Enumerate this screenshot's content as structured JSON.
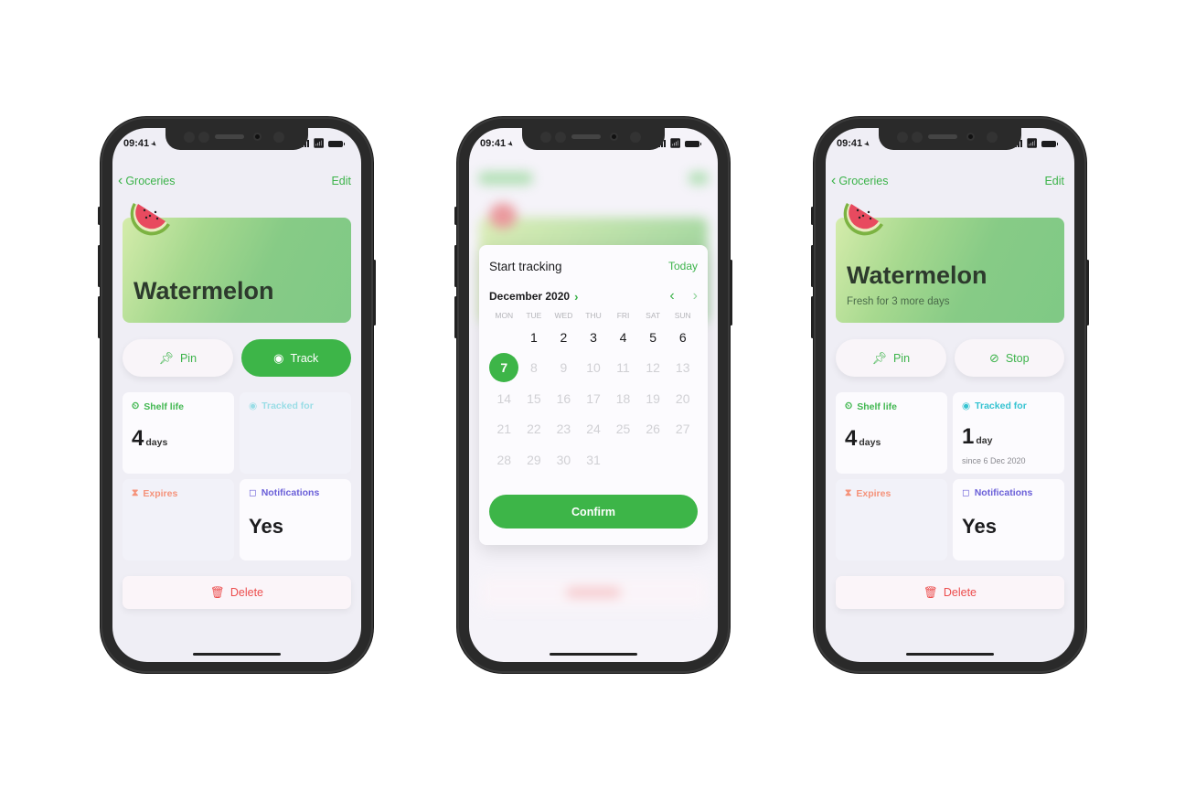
{
  "status_bar": {
    "time": "09:41"
  },
  "screens": [
    {
      "nav": {
        "back_label": "Groceries",
        "edit_label": "Edit"
      },
      "hero": {
        "title": "Watermelon",
        "subtitle": null
      },
      "actions": {
        "pin_label": "Pin",
        "track_label": "Track"
      },
      "cells": {
        "shelf_life": {
          "label": "Shelf life",
          "value": "4",
          "unit": "days"
        },
        "tracked_for": {
          "label": "Tracked for"
        },
        "expires": {
          "label": "Expires"
        },
        "notifications": {
          "label": "Notifications",
          "value": "Yes"
        }
      },
      "delete_label": "Delete"
    },
    {
      "sheet": {
        "title": "Start tracking",
        "today_label": "Today",
        "month_label": "December 2020",
        "weekdays": [
          "MON",
          "TUE",
          "WED",
          "THU",
          "FRI",
          "SAT",
          "SUN"
        ],
        "leading_blanks": 1,
        "days": [
          "1",
          "2",
          "3",
          "4",
          "5",
          "6",
          "7",
          "8",
          "9",
          "10",
          "11",
          "12",
          "13",
          "14",
          "15",
          "16",
          "17",
          "18",
          "19",
          "20",
          "21",
          "22",
          "23",
          "24",
          "25",
          "26",
          "27",
          "28",
          "29",
          "30",
          "31"
        ],
        "available_days": [
          "1",
          "2",
          "3",
          "4",
          "5",
          "6",
          "7"
        ],
        "selected_day": "7",
        "confirm_label": "Confirm"
      }
    },
    {
      "nav": {
        "back_label": "Groceries",
        "edit_label": "Edit"
      },
      "hero": {
        "title": "Watermelon",
        "subtitle": "Fresh for 3 more days"
      },
      "actions": {
        "pin_label": "Pin",
        "stop_label": "Stop"
      },
      "cells": {
        "shelf_life": {
          "label": "Shelf life",
          "value": "4",
          "unit": "days"
        },
        "tracked_for": {
          "label": "Tracked for",
          "value": "1",
          "unit": "day",
          "since": "since 6 Dec 2020"
        },
        "expires": {
          "label": "Expires"
        },
        "notifications": {
          "label": "Notifications",
          "value": "Yes"
        }
      },
      "delete_label": "Delete"
    }
  ],
  "colors": {
    "accent_green": "#3db548",
    "shelf_life": "#43b852",
    "tracked_for": "#35c3d1",
    "expires": "#f5937b",
    "notifications": "#6a5fd8",
    "delete": "#ec4d4d"
  }
}
